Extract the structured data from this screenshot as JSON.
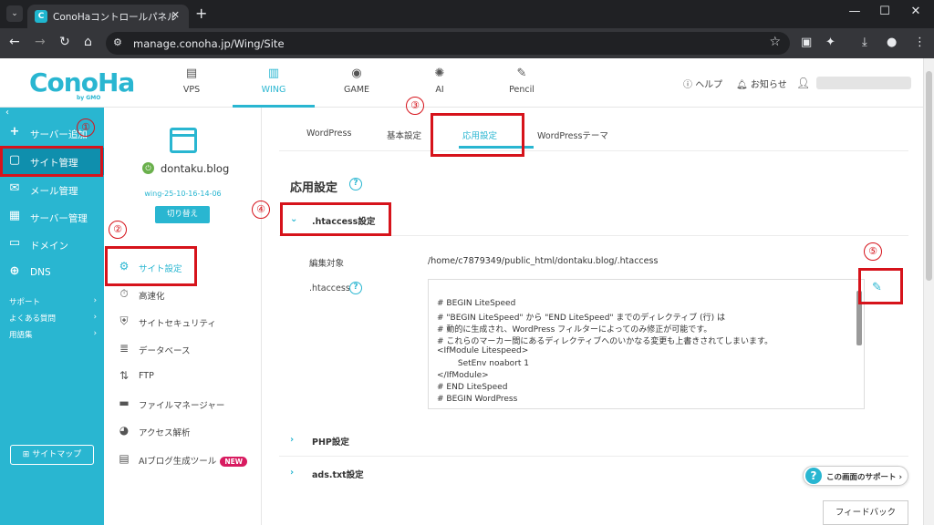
{
  "browser": {
    "tab_title": "ConoHaコントロールパネル",
    "favicon": "C",
    "url": "manage.conoha.jp/Wing/Site"
  },
  "header": {
    "logo": "ConoHa",
    "logo_sub": "by GMO",
    "nav": [
      {
        "label": "VPS",
        "icon": "server-icon"
      },
      {
        "label": "WING",
        "icon": "wing-icon",
        "active": true
      },
      {
        "label": "GAME",
        "icon": "gamepad-icon"
      },
      {
        "label": "AI",
        "icon": "ai-chip-icon"
      },
      {
        "label": "Pencil",
        "icon": "pencil-doc-icon"
      }
    ],
    "help": "ヘルプ",
    "notice": "お知らせ"
  },
  "sidebar": {
    "items": [
      {
        "label": "サーバー追加",
        "icon": "plus-icon"
      },
      {
        "label": "サイト管理",
        "icon": "window-icon",
        "active": true
      },
      {
        "label": "メール管理",
        "icon": "mail-icon"
      },
      {
        "label": "サーバー管理",
        "icon": "server-manage-icon"
      },
      {
        "label": "ドメイン",
        "icon": "domain-icon"
      },
      {
        "label": "DNS",
        "icon": "globe-icon"
      }
    ],
    "links": [
      "サポート",
      "よくある質問",
      "用語集"
    ],
    "sitemap": "サイトマップ"
  },
  "site_panel": {
    "name": "dontaku.blog",
    "id": "wing-25-10-16-14-06",
    "switch": "切り替え",
    "menu": [
      {
        "label": "サイト設定",
        "icon": "gear-icon",
        "active": true
      },
      {
        "label": "高速化",
        "icon": "stopwatch-icon"
      },
      {
        "label": "サイトセキュリティ",
        "icon": "shield-icon"
      },
      {
        "label": "データベース",
        "icon": "database-icon"
      },
      {
        "label": "FTP",
        "icon": "transfer-icon"
      },
      {
        "label": "ファイルマネージャー",
        "icon": "folder-icon"
      },
      {
        "label": "アクセス解析",
        "icon": "pie-chart-icon"
      },
      {
        "label": "AIブログ生成ツール",
        "icon": "ai-doc-icon",
        "badge": "NEW"
      }
    ]
  },
  "main": {
    "tabs": [
      "WordPress",
      "基本設定",
      "応用設定",
      "WordPressテーマ"
    ],
    "active_tab": "応用設定",
    "title": "応用設定",
    "htaccess_section": ".htaccess設定",
    "target_label": "編集対象",
    "target_value": "/home/c7879349/public_html/dontaku.blog/.htaccess",
    "htaccess_label": ".htaccess",
    "code_lines": [
      "# BEGIN LiteSpeed",
      "# \"BEGIN LiteSpeed\" から \"END LiteSpeed\" までのディレクティブ (行) は",
      "# 動的に生成され、WordPress フィルターによってのみ修正が可能です。",
      "# これらのマーカー間にあるディレクティブへのいかなる変更も上書きされてしまいます。",
      "<IfModule Litespeed>",
      "        SetEnv noabort 1",
      "</IfModule>",
      "# END LiteSpeed",
      "# BEGIN WordPress"
    ],
    "php_section": "PHP設定",
    "ads_section": "ads.txt設定",
    "support": "この画面のサポート",
    "feedback": "フィードバック"
  },
  "annotations": [
    "①",
    "②",
    "③",
    "④",
    "⑤"
  ],
  "colors": {
    "accent": "#29b6d1",
    "sidebar_active": "#0f8fad",
    "annotation": "#d6131b",
    "new_badge": "#d81b60"
  }
}
